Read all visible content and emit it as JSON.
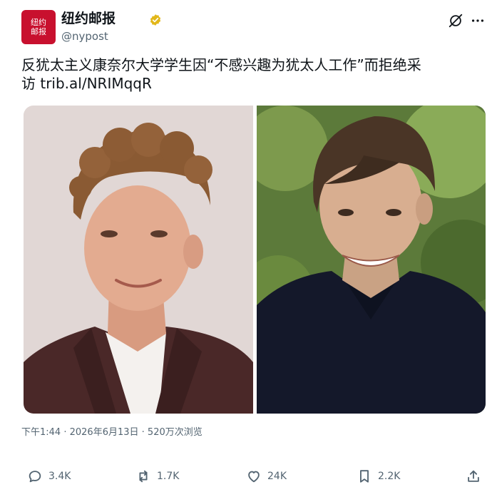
{
  "author": {
    "avatar_text_line1": "纽约",
    "avatar_text_line2": "邮报",
    "display_name": "纽约邮报",
    "handle": "@nypost",
    "verified_icon": "verified-badge-icon"
  },
  "header_icons": [
    "grok-icon",
    "more-icon"
  ],
  "tweet": {
    "text": "反犹太主义康奈尔大学学生因“不感兴趣为犹太人工作”而拒绝采\n访 trib.al/NRIMqqR"
  },
  "media": {
    "left_photo": "photo-man-curly-hair-brown-blazer",
    "right_photo": "photo-young-man-dark-polo-outdoors"
  },
  "meta": {
    "time": "下午1:44",
    "separator": " · ",
    "date": "2026年6月13日",
    "views": "520万次浏览"
  },
  "actions": {
    "replies": "3.4K",
    "reposts": "1.7K",
    "likes": "24K",
    "bookmarks": "2.2K"
  },
  "colors": {
    "brand_red": "#c8102e",
    "verified_gold": "#e2b719",
    "text_primary": "#0f1419",
    "text_secondary": "#536471"
  }
}
